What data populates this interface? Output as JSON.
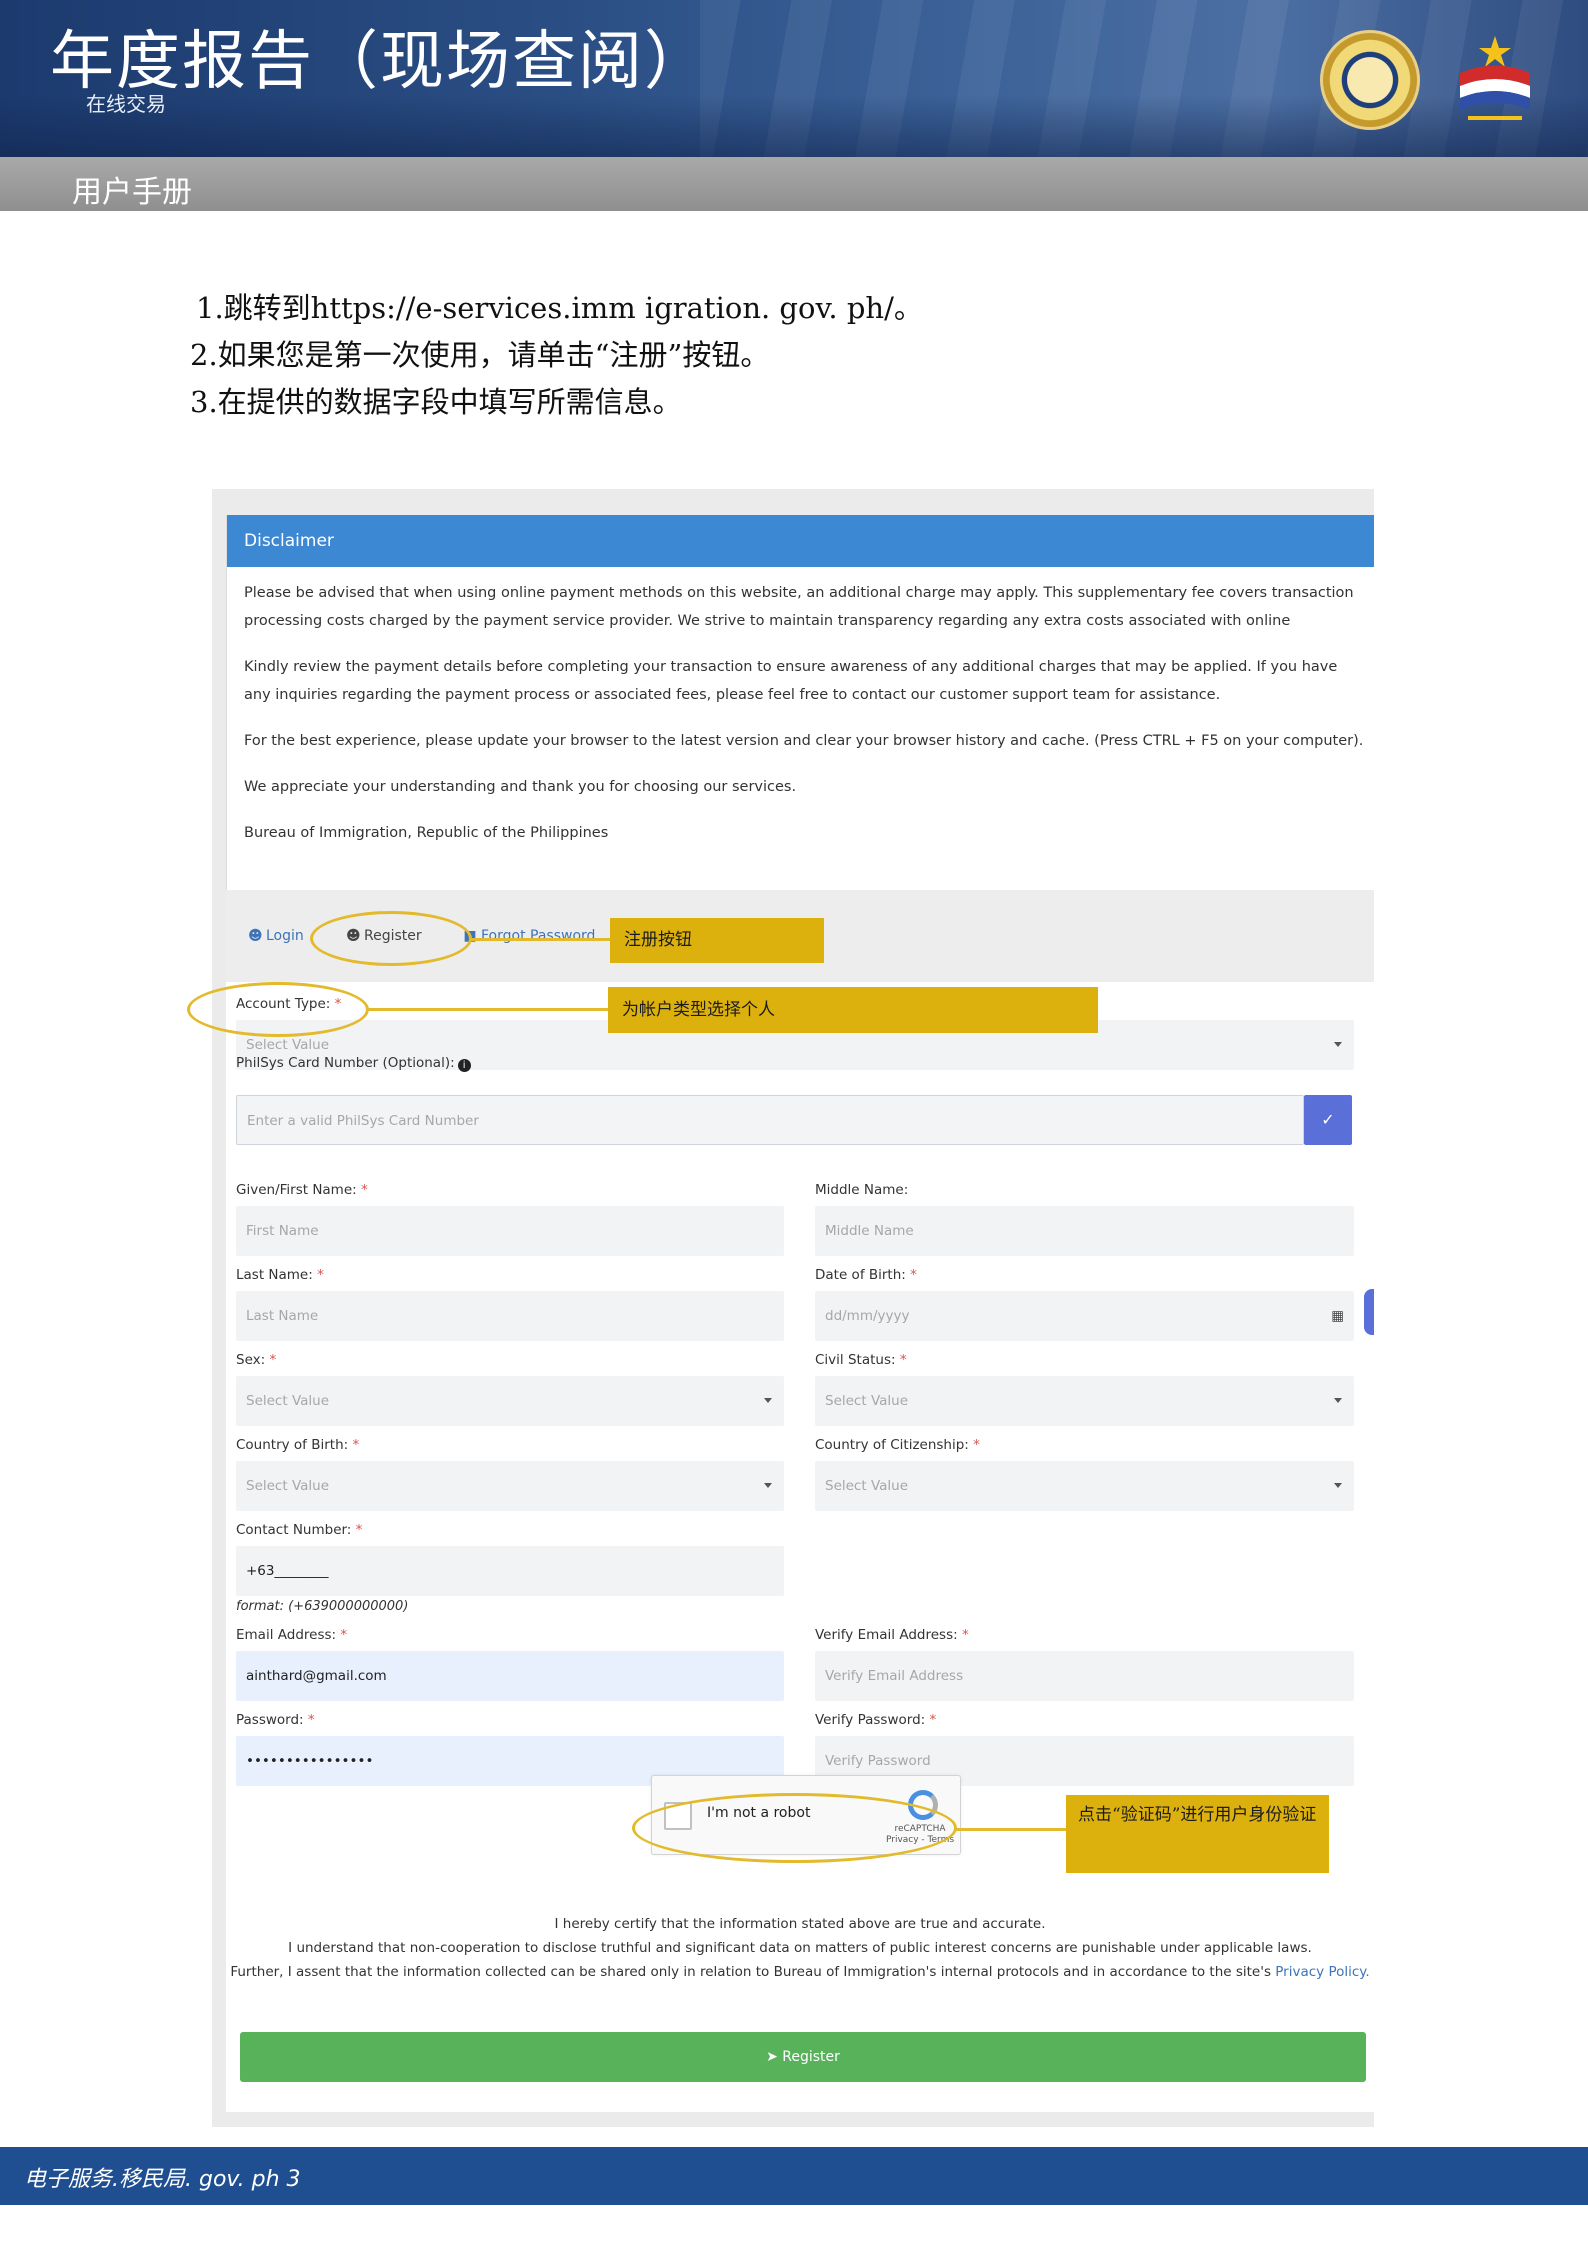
{
  "header": {
    "title": "年度报告（现场查阅）",
    "subtitle": "在线交易",
    "section": "用户手册"
  },
  "steps": [
    "1.跳转到https://e-services.imm igration. gov. ph/。",
    "2.如果您是第一次使用，请单击“注册”按钮。",
    "3.在提供的数据字段中填写所需信息。"
  ],
  "disclaimer": {
    "title": "Disclaimer",
    "paragraphs": [
      "Please be advised that when using online payment methods on this website, an additional charge may apply. This supplementary fee covers transaction processing costs charged by the payment service provider. We strive to maintain transparency regarding any extra costs associated with online transactions.",
      "Kindly review the payment details before completing your transaction to ensure awareness of any additional charges that may be applied. If you have any inquiries regarding the payment process or associated fees, please feel free to contact our customer support team for assistance.",
      "For the best experience, please update your browser to the latest version and clear your browser history and cache. (Press CTRL + F5 on your computer).",
      "We appreciate your understanding and thank you for choosing our services.",
      "Bureau of Immigration, Republic of the Philippines"
    ]
  },
  "tabs": {
    "login": "Login",
    "register": "Register",
    "forgot": "Forgot Password"
  },
  "form": {
    "account_type": {
      "label": "Account Type:",
      "placeholder": "Select Value"
    },
    "philsys": {
      "label": "PhilSys Card Number (Optional):",
      "placeholder": "Enter a valid PhilSys Card Number"
    },
    "first_name": {
      "label": "Given/First Name:",
      "placeholder": "First Name"
    },
    "middle_name": {
      "label": "Middle Name:",
      "placeholder": "Middle Name"
    },
    "last_name": {
      "label": "Last Name:",
      "placeholder": "Last Name"
    },
    "dob": {
      "label": "Date of Birth:",
      "placeholder": "dd/mm/yyyy"
    },
    "sex": {
      "label": "Sex:",
      "placeholder": "Select Value"
    },
    "civil_status": {
      "label": "Civil Status:",
      "placeholder": "Select Value"
    },
    "country_birth": {
      "label": "Country of Birth:",
      "placeholder": "Select Value"
    },
    "country_citizenship": {
      "label": "Country of Citizenship:",
      "placeholder": "Select Value"
    },
    "contact": {
      "label": "Contact Number:",
      "value": "+63________",
      "hint": "format: (+639000000000)"
    },
    "email": {
      "label": "Email Address:",
      "value": "ainthard@gmail.com"
    },
    "verify_email": {
      "label": "Verify Email Address:",
      "placeholder": "Verify Email Address"
    },
    "password": {
      "label": "Password:",
      "value": "••••••••••••••••"
    },
    "verify_password": {
      "label": "Verify Password:",
      "placeholder": "Verify Password"
    },
    "required_mark": "*"
  },
  "captcha": {
    "label": "I'm not a robot",
    "brand": "reCAPTCHA",
    "terms": "Privacy - Terms"
  },
  "certification": {
    "line1": "I hereby certify that the information stated above are true and accurate.",
    "line2": "I understand that non-cooperation to disclose truthful and significant data on matters of public interest concerns are punishable under applicable laws.",
    "line3": "Further, I assent that the information collected can be shared only in relation to Bureau of Immigration's internal protocols and in accordance to the site's",
    "link": "Privacy Policy."
  },
  "register_button": "Register",
  "annotations": {
    "register": "注册按钮",
    "account_type": "为帐户类型选择个人",
    "captcha": "点击“验证码”进行用户身份验证"
  },
  "footer": "电子服务.移民局. gov. ph 3",
  "colors": {
    "banner": "#2a4e84",
    "callout": "#dcb10d",
    "disclaimer_header": "#3d88d3",
    "register_button": "#57b25a",
    "footer": "#1f4f91"
  }
}
